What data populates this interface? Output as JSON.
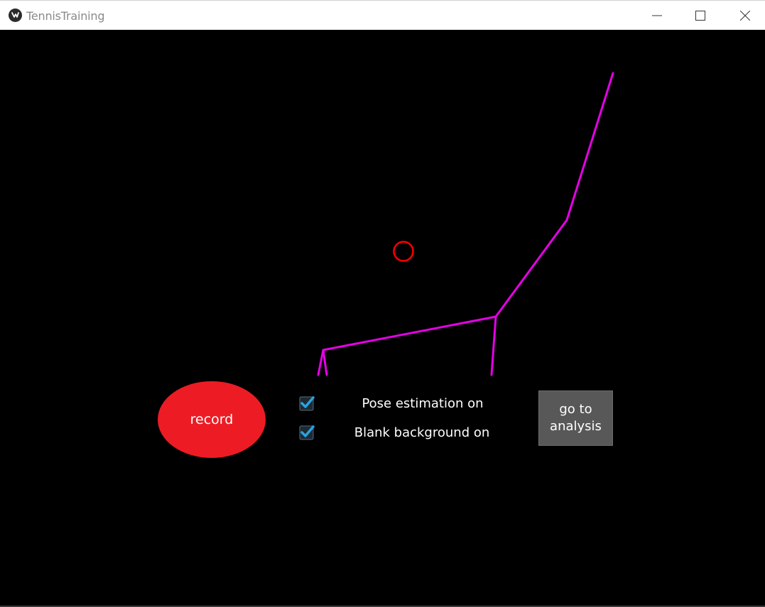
{
  "window": {
    "title": "TennisTraining",
    "app_icon": "kivy-logo-icon",
    "controls": {
      "minimize_icon": "minimize-icon",
      "maximize_icon": "maximize-icon",
      "close_icon": "close-icon"
    }
  },
  "main": {
    "record_label": "record",
    "options": [
      {
        "label": "Pose estimation on",
        "checked": true
      },
      {
        "label": "Blank background on",
        "checked": true
      }
    ],
    "analysis_label": "go to\nanalysis"
  },
  "colors": {
    "background": "#000000",
    "pose_lines": "#e600e6",
    "target_circle": "#ff0000",
    "record_button": "#ed1c24",
    "analysis_button": "#585858",
    "checkbox_tick": "#29a3e0"
  }
}
